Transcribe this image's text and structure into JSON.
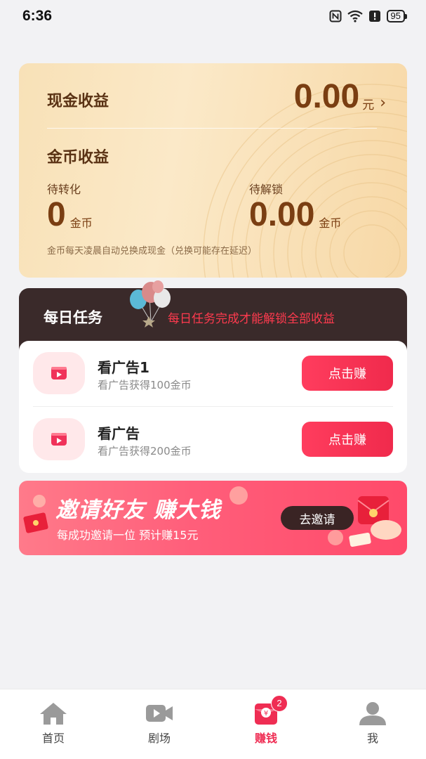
{
  "status_bar": {
    "time": "6:36",
    "battery": "95"
  },
  "earnings": {
    "cash_label": "现金收益",
    "cash_amount": "0.00",
    "cash_unit": "元",
    "coin_label": "金币收益",
    "pending_convert_label": "待转化",
    "pending_convert_value": "0",
    "pending_convert_unit": "金币",
    "pending_unlock_label": "待解锁",
    "pending_unlock_value": "0.00",
    "pending_unlock_unit": "金币",
    "note": "金币每天凌晨自动兑换成现金（兑换可能存在延迟）"
  },
  "daily_tasks": {
    "title": "每日任务",
    "tip": "每日任务完成才能解锁全部收益",
    "items": [
      {
        "name": "看广告1",
        "desc": "看广告获得100金币",
        "button": "点击赚"
      },
      {
        "name": "看广告",
        "desc": "看广告获得200金币",
        "button": "点击赚"
      }
    ]
  },
  "invite": {
    "title": "邀请好友 赚大钱",
    "subtitle": "每成功邀请一位 预计赚15元",
    "button": "去邀请"
  },
  "bottom_nav": {
    "items": [
      {
        "label": "首页",
        "icon": "home-icon"
      },
      {
        "label": "剧场",
        "icon": "video-camera-icon"
      },
      {
        "label": "赚钱",
        "icon": "red-envelope-icon",
        "badge": "2",
        "active": true
      },
      {
        "label": "我",
        "icon": "user-icon"
      }
    ]
  },
  "colors": {
    "accent": "#ef2d53",
    "card_gold": "#f8e1b7",
    "task_header": "#3a2a2a"
  }
}
